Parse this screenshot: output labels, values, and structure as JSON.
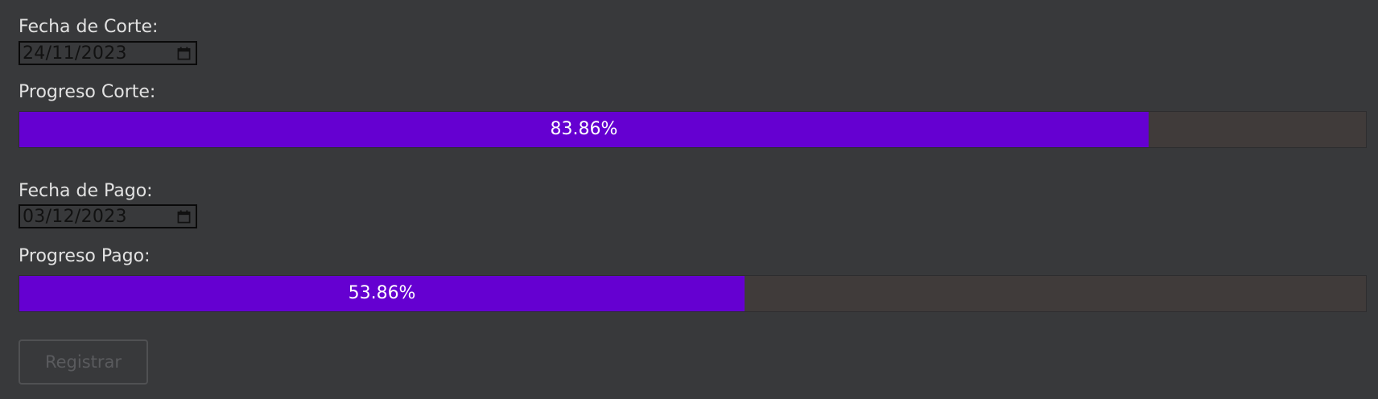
{
  "cut": {
    "date_label": "Fecha de Corte:",
    "date_value": "24/11/2023",
    "progress_label": "Progreso Corte:",
    "progress_percent": 83.86,
    "progress_text": "83.86%"
  },
  "payment": {
    "date_label": "Fecha de Pago:",
    "date_value": "03/12/2023",
    "progress_label": "Progreso Pago:",
    "progress_percent": 53.86,
    "progress_text": "53.86%"
  },
  "register_button": {
    "label": "Registrar",
    "disabled": true
  },
  "colors": {
    "background": "#38393b",
    "progress_fill": "#6500d1",
    "progress_track": "#403b3a"
  },
  "icons": {
    "date_picker": "calendar-icon"
  }
}
